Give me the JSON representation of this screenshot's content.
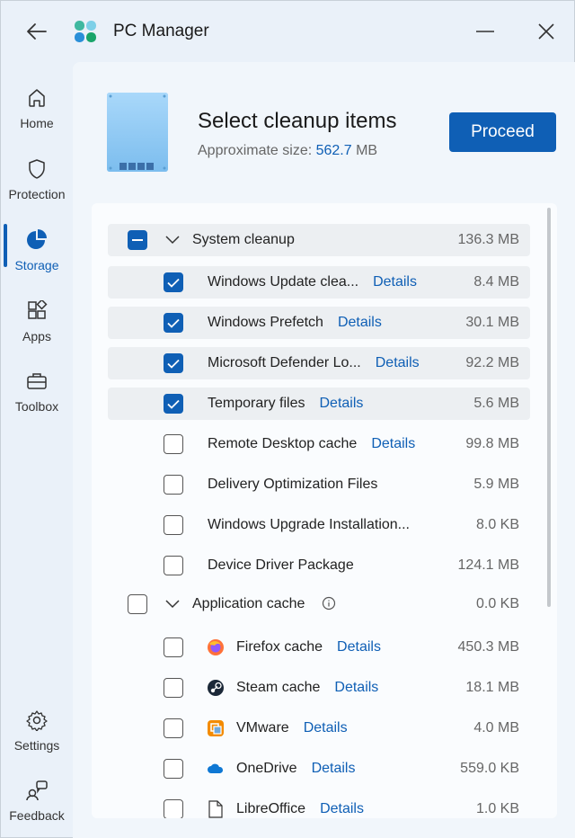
{
  "app": {
    "title": "PC Manager"
  },
  "nav": [
    {
      "label": "Home",
      "icon": "home-icon"
    },
    {
      "label": "Protection",
      "icon": "shield-icon"
    },
    {
      "label": "Storage",
      "icon": "pie-chart-icon",
      "active": true
    },
    {
      "label": "Apps",
      "icon": "apps-icon"
    },
    {
      "label": "Toolbox",
      "icon": "toolbox-icon"
    },
    {
      "label": "Settings",
      "icon": "gear-icon"
    },
    {
      "label": "Feedback",
      "icon": "feedback-icon"
    }
  ],
  "header": {
    "title": "Select cleanup items",
    "sub_prefix": "Approximate size: ",
    "size_value": "562.7",
    "size_unit": " MB",
    "proceed": "Proceed"
  },
  "groups": {
    "system": {
      "label": "System cleanup",
      "size": "136.3 MB",
      "state": "partial"
    },
    "appcache": {
      "label": "Application cache",
      "size": "0.0 KB",
      "state": "off"
    }
  },
  "system_items": [
    {
      "label": "Windows Update clea...",
      "details": "Details",
      "size": "8.4 MB",
      "checked": true
    },
    {
      "label": "Windows Prefetch",
      "details": "Details",
      "size": "30.1 MB",
      "checked": true
    },
    {
      "label": "Microsoft Defender Lo...",
      "details": "Details",
      "size": "92.2 MB",
      "checked": true
    },
    {
      "label": "Temporary files",
      "details": "Details",
      "size": "5.6 MB",
      "checked": true
    },
    {
      "label": "Remote Desktop cache",
      "details": "Details",
      "size": "99.8 MB",
      "checked": false
    },
    {
      "label": "Delivery Optimization Files",
      "details": "",
      "size": "5.9 MB",
      "checked": false
    },
    {
      "label": "Windows Upgrade Installation...",
      "details": "",
      "size": "8.0 KB",
      "checked": false
    },
    {
      "label": "Device Driver Package",
      "details": "",
      "size": "124.1 MB",
      "checked": false
    }
  ],
  "app_items": [
    {
      "label": "Firefox cache",
      "details": "Details",
      "size": "450.3 MB",
      "icon": "firefox-icon"
    },
    {
      "label": "Steam cache",
      "details": "Details",
      "size": "18.1 MB",
      "icon": "steam-icon"
    },
    {
      "label": "VMware",
      "details": "Details",
      "size": "4.0 MB",
      "icon": "vmware-icon"
    },
    {
      "label": "OneDrive",
      "details": "Details",
      "size": "559.0 KB",
      "icon": "onedrive-icon"
    },
    {
      "label": "LibreOffice",
      "details": "Details",
      "size": "1.0 KB",
      "icon": "libreoffice-icon"
    }
  ],
  "colors": {
    "accent": "#0f5fb5",
    "row_shade": "#eceff2"
  }
}
